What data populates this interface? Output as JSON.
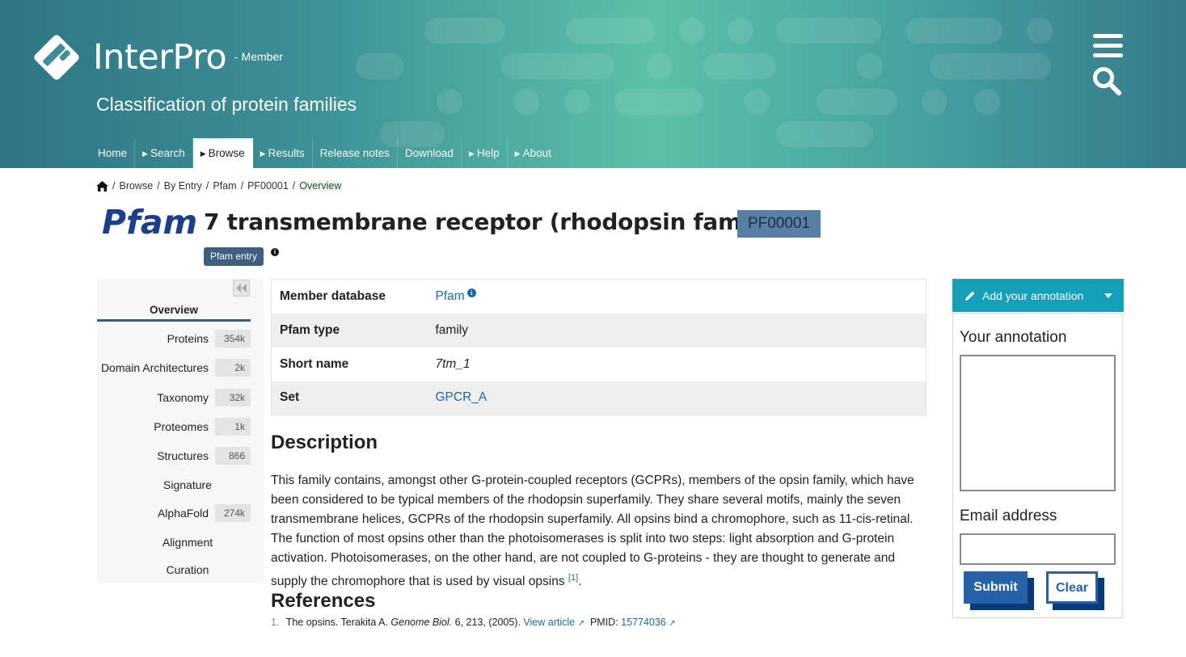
{
  "header": {
    "brand": "InterPro",
    "brand_sub": "- Member",
    "tagline": "Classification of protein families",
    "nav": [
      {
        "label": "Home",
        "caret": false,
        "active": false
      },
      {
        "label": "Search",
        "caret": true,
        "active": false
      },
      {
        "label": "Browse",
        "caret": true,
        "active": true
      },
      {
        "label": "Results",
        "caret": true,
        "active": false
      },
      {
        "label": "Release notes",
        "caret": false,
        "active": false
      },
      {
        "label": "Download",
        "caret": false,
        "active": false
      },
      {
        "label": "Help",
        "caret": true,
        "active": false
      },
      {
        "label": "About",
        "caret": true,
        "active": false
      }
    ]
  },
  "breadcrumb": {
    "items": [
      "Browse",
      "By Entry",
      "Pfam",
      "PF00001"
    ],
    "current": "Overview",
    "separator": "/"
  },
  "entry": {
    "db_logo_text": "Pfam",
    "title": "7 transmembrane receptor (rhodopsin family)",
    "accession": "PF00001",
    "entry_type_badge": "Pfam entry"
  },
  "side_menu": {
    "overview": "Overview",
    "items": [
      {
        "label": "Proteins",
        "count": "354k"
      },
      {
        "label": "Domain Architectures",
        "count": "2k"
      },
      {
        "label": "Taxonomy",
        "count": "32k"
      },
      {
        "label": "Proteomes",
        "count": "1k"
      },
      {
        "label": "Structures",
        "count": "866"
      },
      {
        "label": "Signature",
        "count": ""
      },
      {
        "label": "AlphaFold",
        "count": "274k"
      },
      {
        "label": "Alignment",
        "count": ""
      },
      {
        "label": "Curation",
        "count": ""
      }
    ]
  },
  "info_table": {
    "rows": [
      {
        "key": "Member database",
        "value": "Pfam"
      },
      {
        "key": "Pfam type",
        "value": "family"
      },
      {
        "key": "Short name",
        "value": "7tm_1"
      },
      {
        "key": "Set",
        "value": "GPCR_A"
      }
    ]
  },
  "description": {
    "heading": "Description",
    "text": "This family contains, amongst other G-protein-coupled receptors (GCPRs), members of the opsin family, which have been considered to be typical members of the rhodopsin superfamily. They share several motifs, mainly the seven transmembrane helices, GCPRs of the rhodopsin superfamily. All opsins bind a chromophore, such as 11-cis-retinal. The function of most opsins other than the photoisomerases is split into two steps: light absorption and G-protein activation. Photoisomerases, on the other hand, are not coupled to G-proteins - they are thought to generate and supply the chromophore that is used by visual opsins",
    "citation": "[1]",
    "end": "."
  },
  "references": {
    "heading": "References",
    "items": [
      {
        "num": "1.",
        "text": "The opsins. Terakita A.",
        "journal": "Genome Biol.",
        "details": "6, 213, (2005).",
        "view_label": "View article",
        "pmid_label": "PMID:",
        "pmid": "15774036"
      }
    ]
  },
  "annotation": {
    "button_label": "Add your annotation",
    "your_annotation_label": "Your annotation",
    "email_label": "Email address",
    "annotation_value": "",
    "email_value": "",
    "submit_label": "Submit",
    "clear_label": "Clear"
  }
}
